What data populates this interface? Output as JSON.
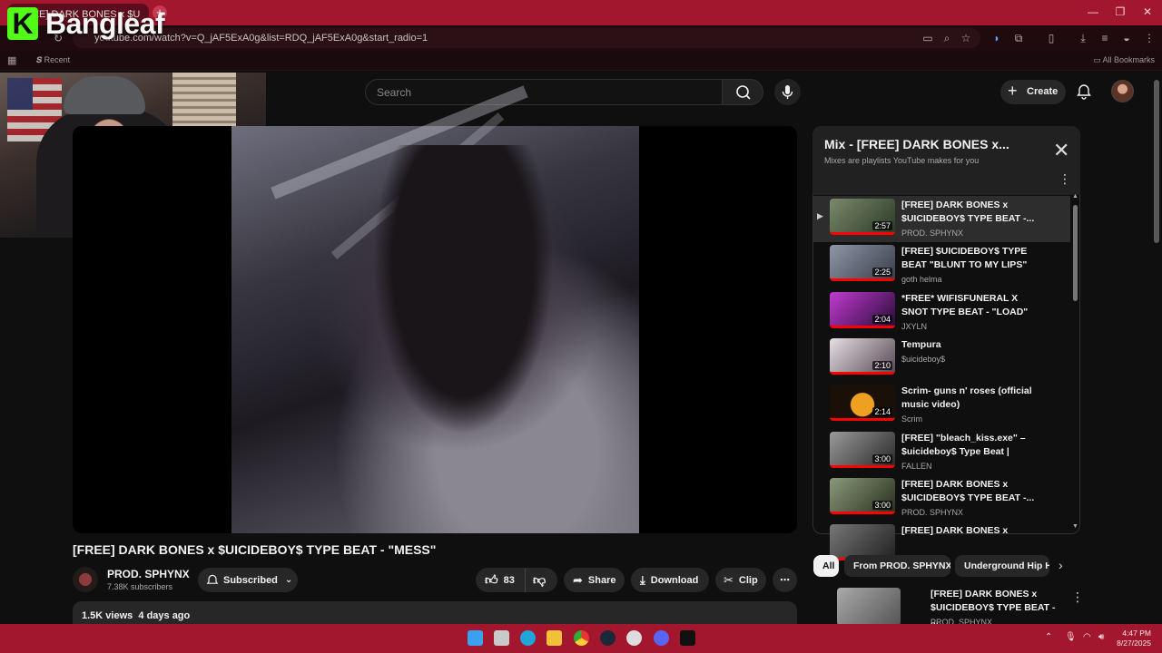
{
  "browser": {
    "tab_title": "[FREE] DARK BONES x $U",
    "url": "youtube.com/watch?v=Q_jAF5ExA0g&list=RDQ_jAF5ExA0g&start_radio=1",
    "bookmark_recent": "Recent",
    "all_bookmarks": "All Bookmarks",
    "accent": "#a3172e"
  },
  "overlay": {
    "logo_text": "Bangleaf",
    "logo_letter": "K",
    "logo_color": "#53fc18"
  },
  "header": {
    "search_placeholder": "Search",
    "create_label": "Create"
  },
  "video": {
    "title": "[FREE] DARK BONES x $UICIDEBOY$ TYPE BEAT - \"MESS\"",
    "channel": "PROD. SPHYNX",
    "subscribers": "7.38K subscribers",
    "subscribed_label": "Subscribed",
    "likes": "83",
    "share_label": "Share",
    "download_label": "Download",
    "clip_label": "Clip",
    "views": "1.5K views",
    "uploaded": "4 days ago"
  },
  "playlist": {
    "title": "Mix - [FREE] DARK BONES x...",
    "subtitle": "Mixes are playlists YouTube makes for you",
    "items": [
      {
        "title": "[FREE] DARK BONES x $UICIDEBOY$ TYPE BEAT -...",
        "channel": "PROD. SPHYNX",
        "duration": "2:57",
        "active": true
      },
      {
        "title": "[FREE] $UICIDEBOY$ TYPE BEAT \"BLUNT TO MY LIPS\"",
        "channel": "goth helma",
        "duration": "2:25"
      },
      {
        "title": "*FREE* WIFISFUNERAL X SNOT TYPE BEAT - \"LOAD\"",
        "channel": "JXYLN",
        "duration": "2:04"
      },
      {
        "title": "Tempura",
        "channel": "$uicideboy$",
        "duration": "2:10"
      },
      {
        "title": "Scrim- guns n' roses (official music video)",
        "channel": "Scrim",
        "duration": "2:14"
      },
      {
        "title": "[FREE] \"bleach_kiss.exe\" – $uicideboy$ Type Beat | Prod....",
        "channel": "FALLEN",
        "duration": "3:00"
      },
      {
        "title": "[FREE] DARK BONES x $UICIDEBOY$ TYPE BEAT -...",
        "channel": "PROD. SPHYNX",
        "duration": "3:00"
      },
      {
        "title": "[FREE] DARK BONES x",
        "channel": "",
        "duration": ""
      }
    ]
  },
  "chips": [
    "All",
    "From PROD. SPHYNX",
    "Underground Hip Ho"
  ],
  "recommendation": {
    "title": "[FREE] DARK BONES x $UICIDEBOY$ TYPE BEAT - ...",
    "channel": "PROD. SPHYNX"
  },
  "taskbar": {
    "time": "4:47 PM",
    "date": "8/27/2025"
  }
}
